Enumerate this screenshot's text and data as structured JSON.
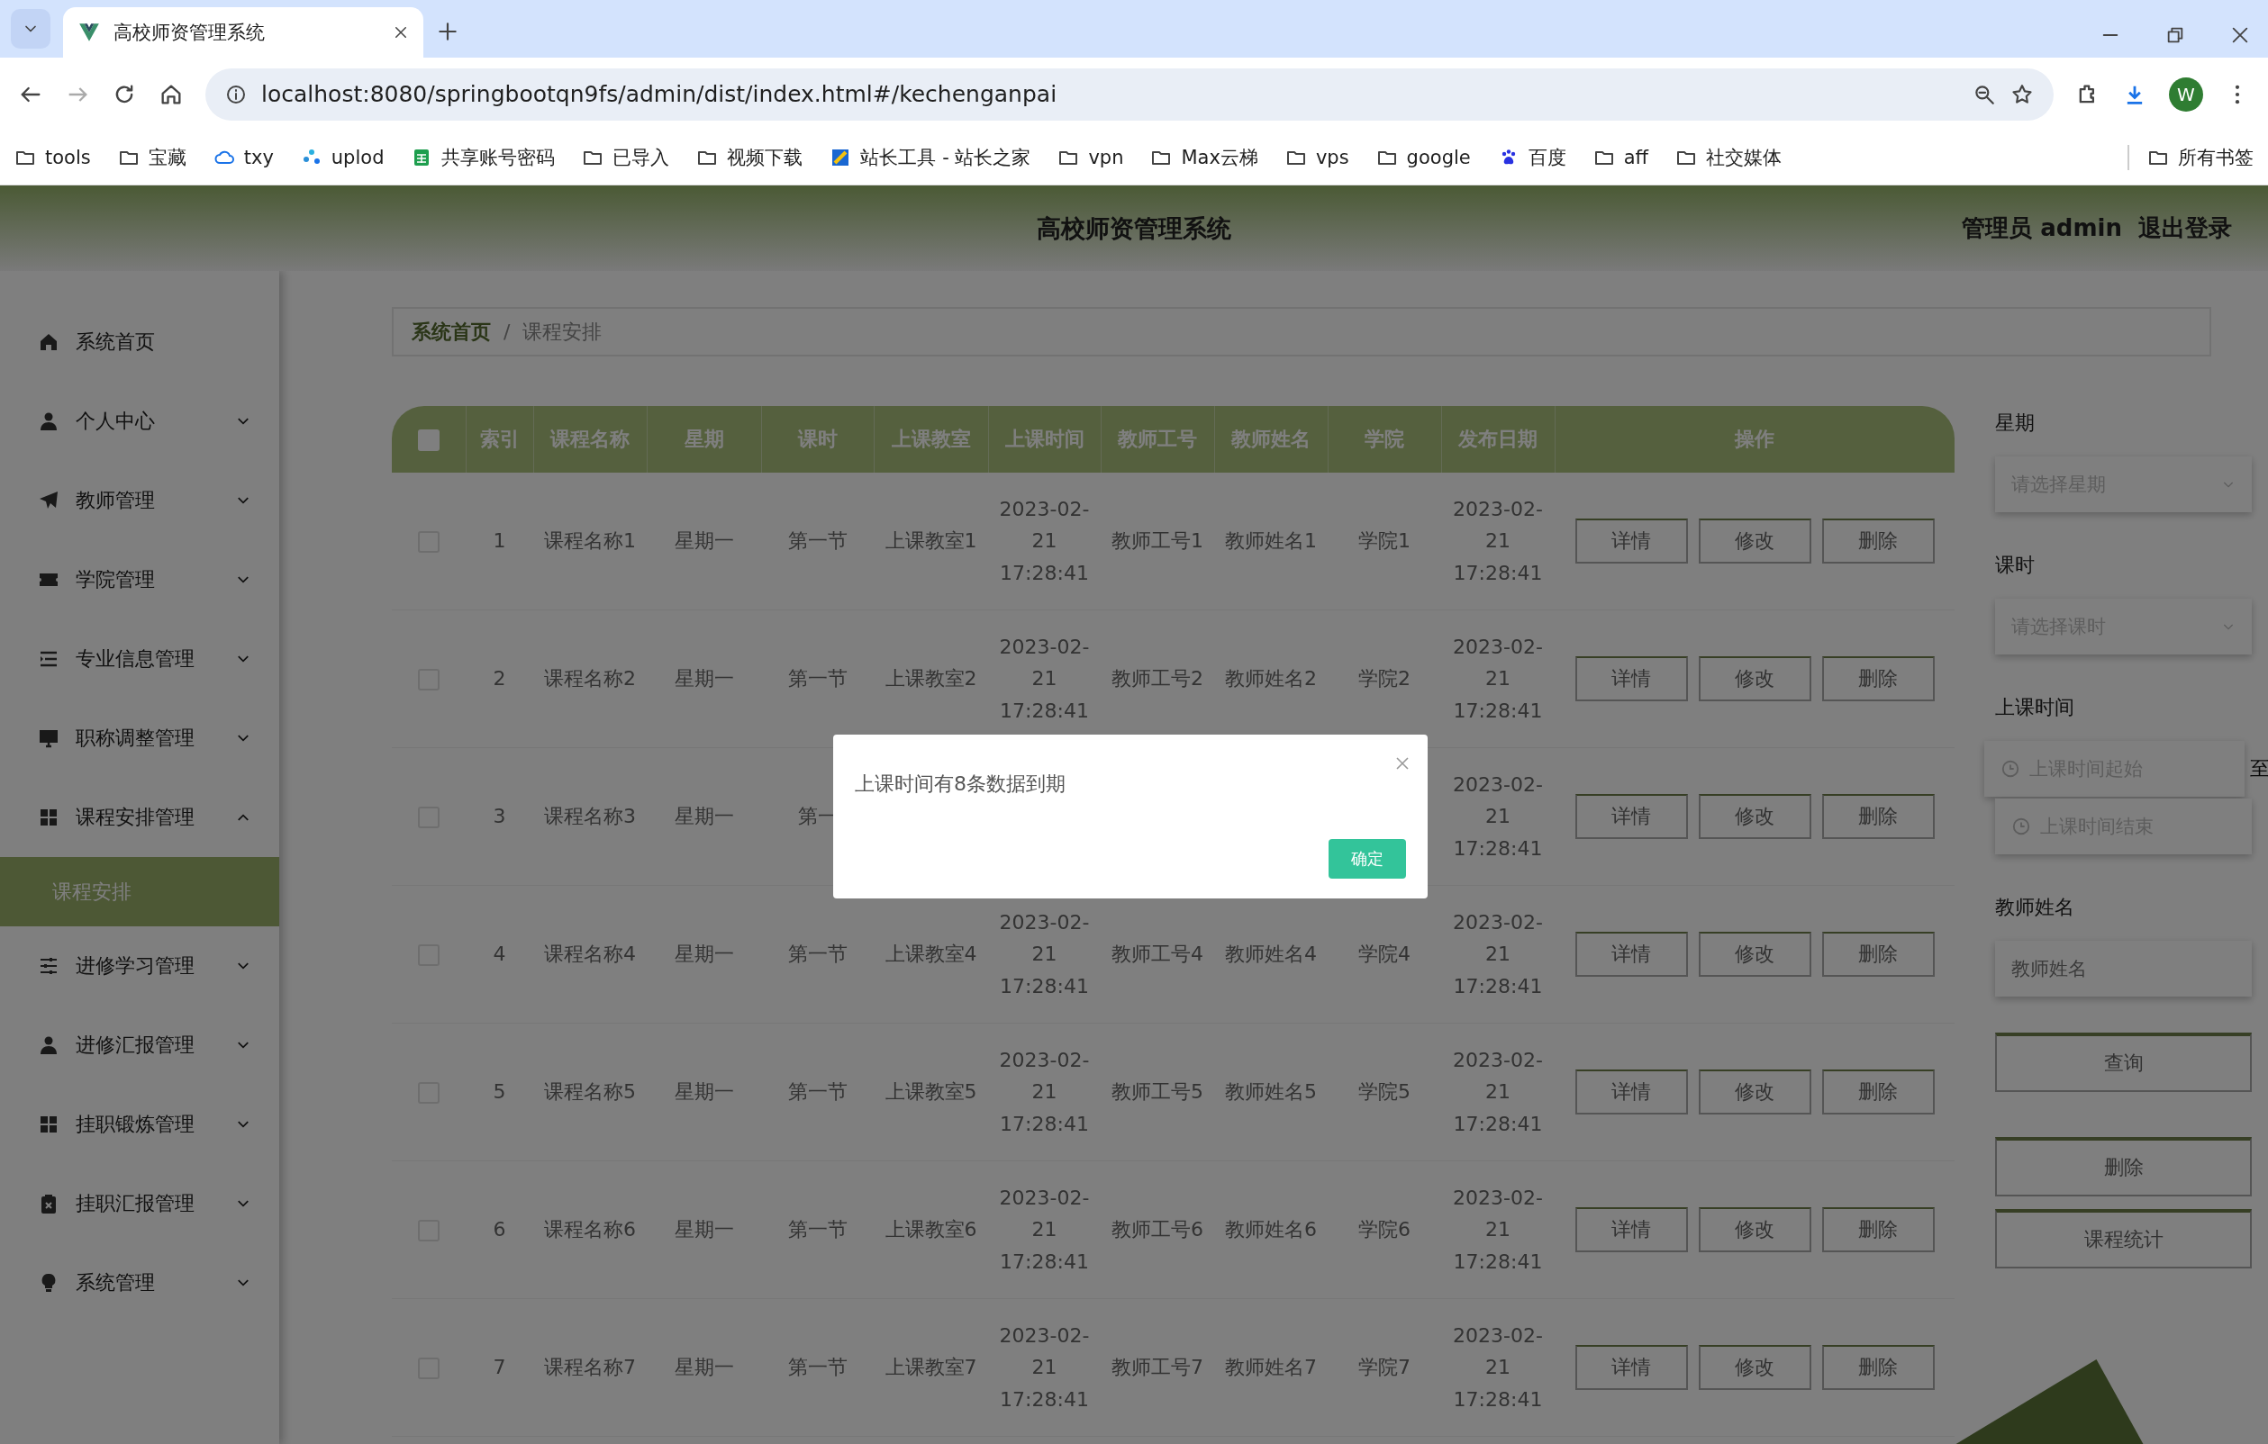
{
  "browser": {
    "tab_title": "高校师资管理系统",
    "url": "localhost:8080/springbootqn9fs/admin/dist/index.html#/kechenganpai",
    "bookmarks": [
      {
        "label": "tools",
        "kind": "folder"
      },
      {
        "label": "宝藏",
        "kind": "folder"
      },
      {
        "label": "txy",
        "kind": "cloud"
      },
      {
        "label": "uplod",
        "kind": "share"
      },
      {
        "label": "共享账号密码",
        "kind": "sheet"
      },
      {
        "label": "已导入",
        "kind": "folder"
      },
      {
        "label": "视频下载",
        "kind": "folder"
      },
      {
        "label": "站长工具 - 站长之家",
        "kind": "site"
      },
      {
        "label": "vpn",
        "kind": "folder"
      },
      {
        "label": "Max云梯",
        "kind": "folder"
      },
      {
        "label": "vps",
        "kind": "folder"
      },
      {
        "label": "google",
        "kind": "folder"
      },
      {
        "label": "百度",
        "kind": "paw"
      },
      {
        "label": "aff",
        "kind": "folder"
      },
      {
        "label": "社交媒体",
        "kind": "folder"
      }
    ],
    "all_bookmarks": "所有书签",
    "profile": "W"
  },
  "header": {
    "title": "高校师资管理系统",
    "user": "管理员 admin",
    "logout": "退出登录"
  },
  "sidebar": {
    "items": [
      {
        "label": "系统首页",
        "kind": "home"
      },
      {
        "label": "个人中心",
        "kind": "user",
        "expanded": false
      },
      {
        "label": "教师管理",
        "kind": "plane",
        "expanded": false
      },
      {
        "label": "学院管理",
        "kind": "ticket",
        "expanded": false
      },
      {
        "label": "专业信息管理",
        "kind": "list",
        "expanded": false
      },
      {
        "label": "职称调整管理",
        "kind": "monitor",
        "expanded": false
      },
      {
        "label": "课程安排管理",
        "kind": "grid",
        "expanded": true,
        "children": [
          {
            "label": "课程安排",
            "selected": true
          }
        ]
      },
      {
        "label": "进修学习管理",
        "kind": "sliders",
        "expanded": false
      },
      {
        "label": "进修汇报管理",
        "kind": "user",
        "expanded": false
      },
      {
        "label": "挂职锻炼管理",
        "kind": "grid",
        "expanded": false
      },
      {
        "label": "挂职汇报管理",
        "kind": "clipboard",
        "expanded": false
      },
      {
        "label": "系统管理",
        "kind": "bulb",
        "expanded": false
      }
    ]
  },
  "breadcrumb": {
    "items": [
      "系统首页",
      "课程安排"
    ],
    "separator": "/"
  },
  "table": {
    "select_all": {
      "checked": false
    },
    "columns": [
      "索引",
      "课程名称",
      "星期",
      "课时",
      "上课教室",
      "上课时间",
      "教师工号",
      "教师姓名",
      "学院",
      "发布日期",
      "操作"
    ],
    "rows": [
      {
        "checked": false,
        "cells": [
          "1",
          "课程名称1",
          "星期一",
          "第一节",
          "上课教室1",
          "2023-02-21 17:28:41",
          "教师工号1",
          "教师姓名1",
          "学院1",
          "2023-02-21 17:28:41"
        ],
        "actions": [
          "详情",
          "修改",
          "删除"
        ]
      },
      {
        "checked": false,
        "cells": [
          "2",
          "课程名称2",
          "星期一",
          "第一节",
          "上课教室2",
          "2023-02-21 17:28:41",
          "教师工号2",
          "教师姓名2",
          "学院2",
          "2023-02-21 17:28:41"
        ],
        "actions": [
          "详情",
          "修改",
          "删除"
        ]
      },
      {
        "checked": false,
        "cells": [
          "3",
          "课程名称3",
          "星期一",
          "第一",
          null,
          null,
          null,
          null,
          null,
          "2023-02-21 17:28:41"
        ],
        "actions": [
          "详情",
          "修改",
          "删除"
        ]
      },
      {
        "checked": false,
        "cells": [
          "4",
          "课程名称4",
          "星期一",
          "第一节",
          "上课教室4",
          "2023-02-21 17:28:41",
          "教师工号4",
          "教师姓名4",
          "学院4",
          "2023-02-21 17:28:41"
        ],
        "actions": [
          "详情",
          "修改",
          "删除"
        ]
      },
      {
        "checked": false,
        "cells": [
          "5",
          "课程名称5",
          "星期一",
          "第一节",
          "上课教室5",
          "2023-02-21 17:28:41",
          "教师工号5",
          "教师姓名5",
          "学院5",
          "2023-02-21 17:28:41"
        ],
        "actions": [
          "详情",
          "修改",
          "删除"
        ]
      },
      {
        "checked": false,
        "cells": [
          "6",
          "课程名称6",
          "星期一",
          "第一节",
          "上课教室6",
          "2023-02-21 17:28:41",
          "教师工号6",
          "教师姓名6",
          "学院6",
          "2023-02-21 17:28:41"
        ],
        "actions": [
          "详情",
          "修改",
          "删除"
        ]
      },
      {
        "checked": false,
        "cells": [
          "7",
          "课程名称7",
          "星期一",
          "第一节",
          "上课教室7",
          "2023-02-21 17:28:41",
          "教师工号7",
          "教师姓名7",
          "学院7",
          "2023-02-21 17:28:41"
        ],
        "actions": [
          "详情",
          "修改",
          "删除"
        ]
      }
    ]
  },
  "filters": {
    "fields": [
      {
        "label": "星期",
        "kind": "select",
        "placeholder": "请选择星期"
      },
      {
        "label": "课时",
        "kind": "select",
        "placeholder": "请选择课时"
      },
      {
        "label": "上课时间",
        "kind": "daterange",
        "placeholder": "上课时间起始",
        "separator": "至",
        "placeholder_end": "上课时间结束"
      },
      {
        "label": "教师姓名",
        "kind": "input",
        "placeholder": "教师姓名"
      }
    ],
    "buttons": [
      "查询",
      "删除",
      "课程统计"
    ]
  },
  "dialog": {
    "message": "上课时间有8条数据到期",
    "confirm": "确定"
  }
}
